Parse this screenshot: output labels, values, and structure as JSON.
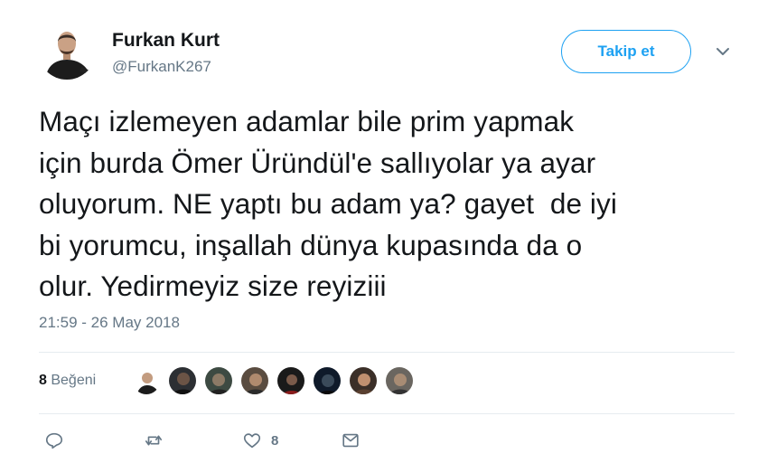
{
  "author": {
    "name": "Furkan Kurt",
    "handle": "@FurkanK267"
  },
  "follow_button": {
    "label": "Takip et"
  },
  "tweet": {
    "text": "Maçı izlemeyen adamlar bile prim yapmak\niçin burda Ömer Üründül'e sallıyolar ya ayar\noluyorum. NE yaptı bu adam ya? gayet  de iyi\nbi yorumcu, inşallah dünya kupasında da o\nolur. Yedirmeyiz size reyiziii",
    "timestamp": "21:59 - 26 May 2018"
  },
  "likes": {
    "count": "8",
    "label": "Beğeni"
  },
  "actions": {
    "reply_icon": "reply-icon",
    "retweet_icon": "retweet-icon",
    "like_icon": "heart-icon",
    "like_count": "8",
    "message_icon": "envelope-icon"
  },
  "colors": {
    "accent": "#1da1f2",
    "secondary_text": "#657786",
    "primary_text": "#14171a",
    "divider": "#e6ecf0"
  }
}
